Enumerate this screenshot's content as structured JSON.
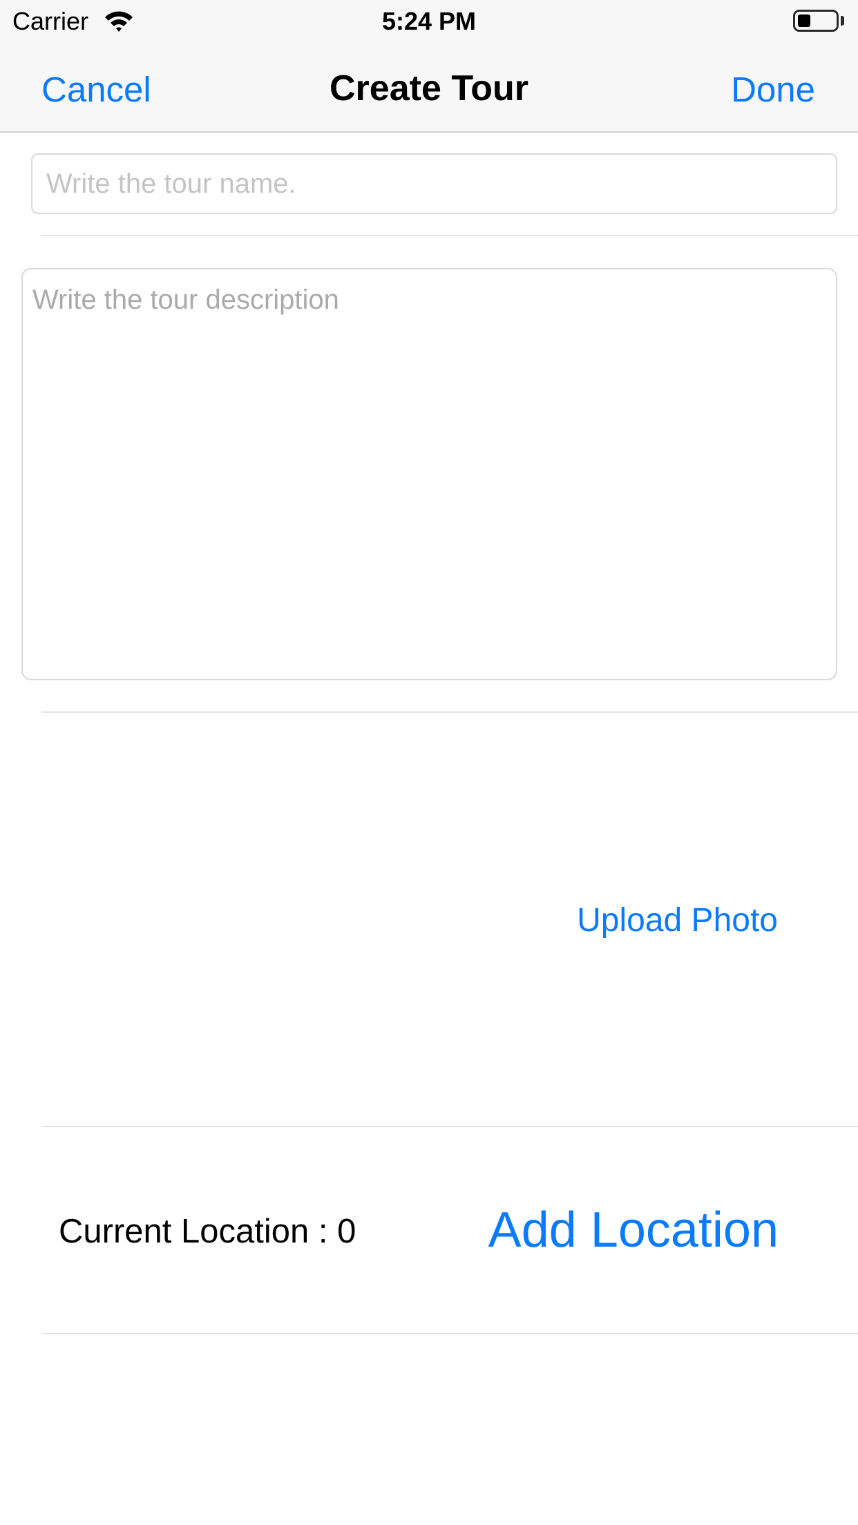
{
  "status_bar": {
    "carrier": "Carrier",
    "time": "5:24 PM",
    "battery_level": 0.35
  },
  "nav": {
    "cancel_label": "Cancel",
    "title": "Create Tour",
    "done_label": "Done"
  },
  "form": {
    "name_value": "",
    "name_placeholder": "Write the tour name.",
    "description_value": "",
    "description_placeholder": "Write the tour description",
    "upload_photo_label": "Upload Photo",
    "current_location_text": "Current Location : 0",
    "add_location_label": "Add Location"
  },
  "colors": {
    "accent": "#0a7aff",
    "bar_background": "#f7f7f7"
  }
}
